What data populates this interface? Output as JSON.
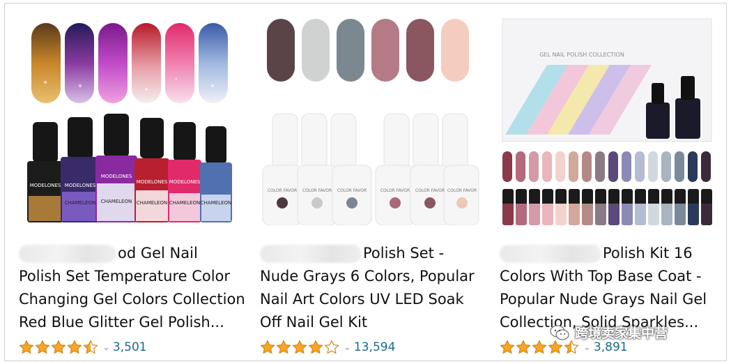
{
  "products": [
    {
      "title_lines": [
        "od Gel Nail",
        "Polish Set Temperature Color",
        "Changing Gel Colors Collection",
        "Red Blue Glitter Gel Polish..."
      ],
      "rating": 4.5,
      "rating_count": "3,501",
      "bottle_label": "MODELONES",
      "bottle_sub": "CHAMELEON"
    },
    {
      "title_lines": [
        "Polish Set -",
        "Nude Grays 6 Colors, Popular",
        "Nail Art Colors UV LED Soak",
        "Off Nail Gel Kit"
      ],
      "rating": 4.0,
      "rating_count": "13,594",
      "bottle_label": "COLOR FAVOR"
    },
    {
      "title_lines": [
        "Polish Kit 16",
        "Colors With Top Base Coat -",
        "Popular Nude Grays Nail Gel",
        "Collection, Solid Sparkles..."
      ],
      "rating": 4.5,
      "rating_count": "3,891",
      "box_title": "GEL NAIL POLISH COLLECTION"
    }
  ],
  "watermark": {
    "text": "跨境卖家集中营",
    "icon": "wechat-icon"
  },
  "colors": {
    "star": "#f5a623",
    "link": "#1a6a8a"
  }
}
